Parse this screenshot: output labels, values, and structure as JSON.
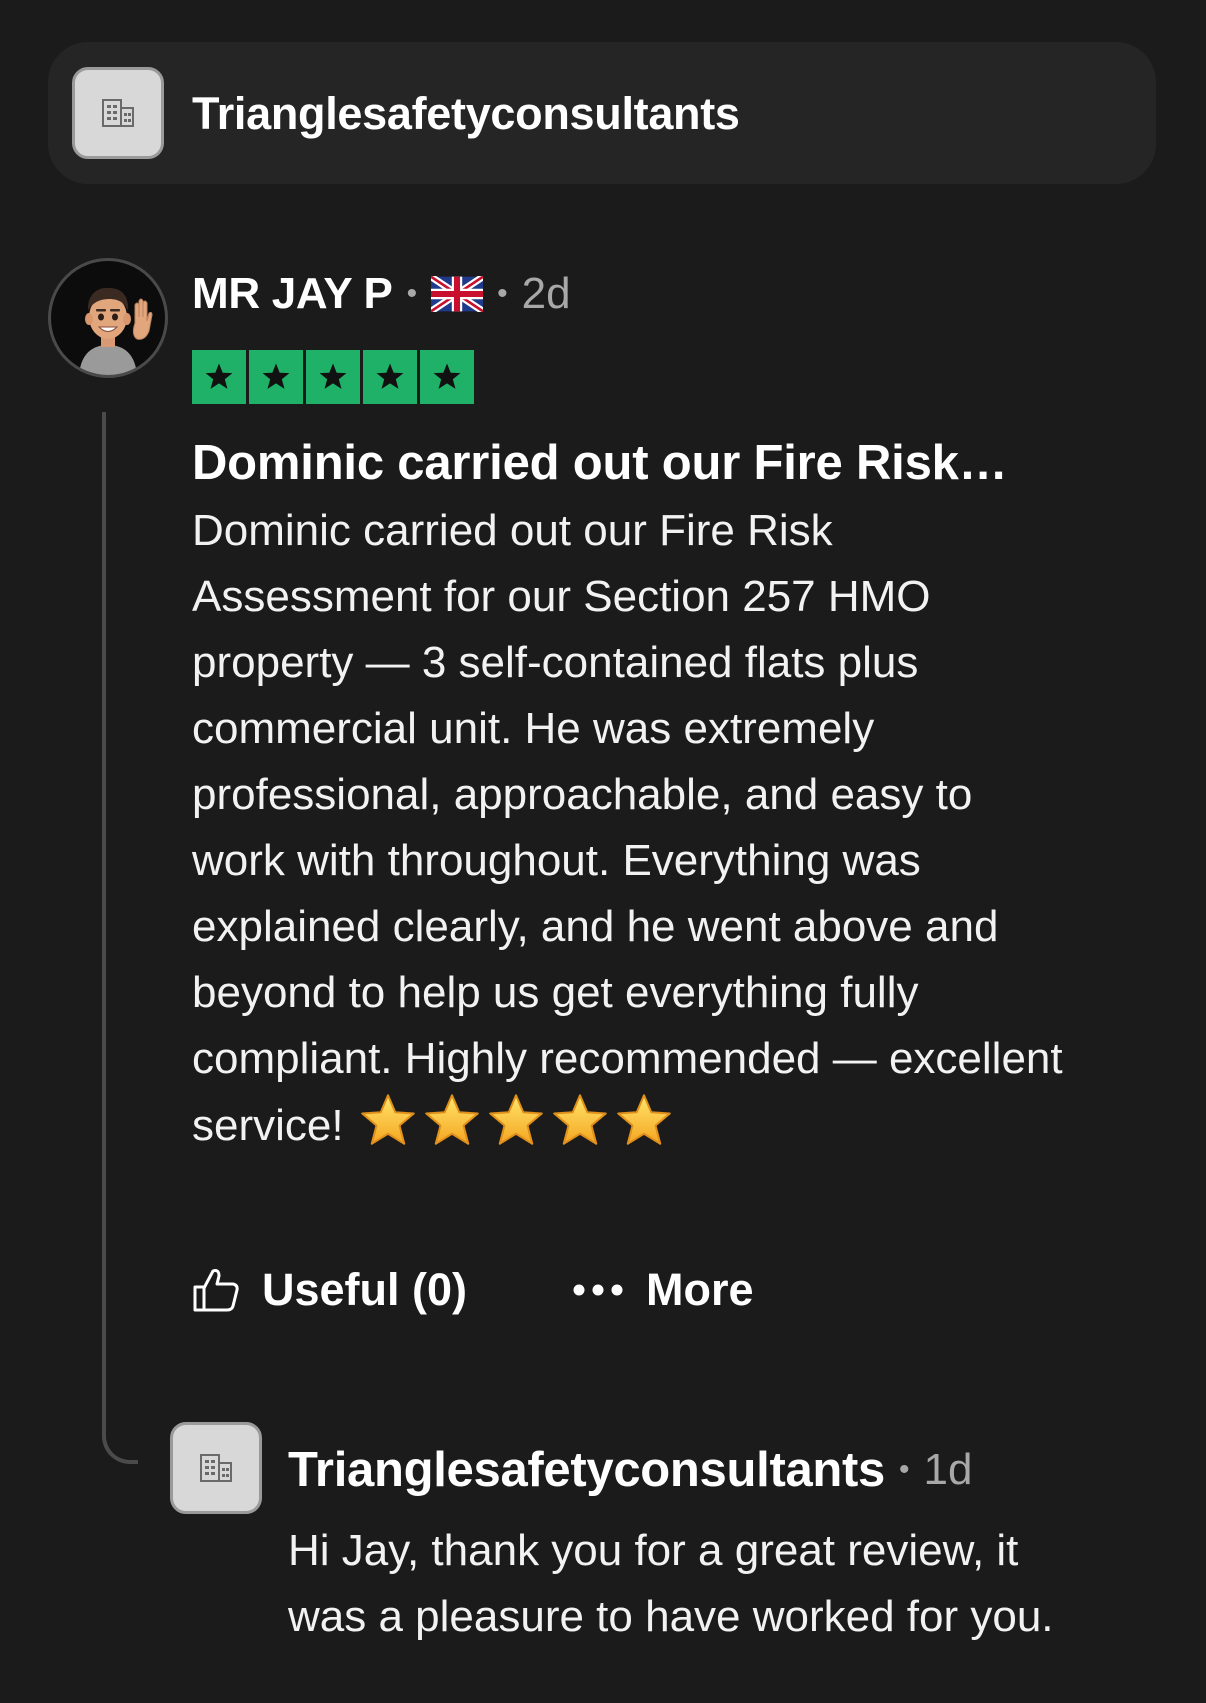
{
  "business": {
    "name": "Trianglesafetyconsultants",
    "logo_icon": "building-icon"
  },
  "review": {
    "author": "MR JAY P",
    "country_icon": "uk-flag-icon",
    "age": "2d",
    "rating": 5,
    "rating_max": 5,
    "title": "Dominic carried out our Fire Risk…",
    "body_lines": [
      "Dominic carried out our Fire Risk",
      "Assessment for our Section 257 HMO",
      "property — 3 self-contained flats plus",
      "commercial unit. He was extremely",
      "professional, approachable, and easy to",
      "work with throughout. Everything was",
      "explained clearly, and he went above and",
      "beyond to help us get everything fully",
      "compliant. Highly recommended — excellent",
      "service!"
    ],
    "emoji_star_count": 5
  },
  "actions": {
    "useful_label": "Useful (0)",
    "more_label": "More"
  },
  "reply": {
    "author": "Trianglesafetyconsultants",
    "age": "1d",
    "body_lines": [
      "Hi Jay, thank you for a great review, it",
      "was a pleasure to have worked for you."
    ]
  },
  "colors": {
    "background": "#1b1b1b",
    "card": "#252525",
    "star_green": "#1fb167",
    "muted_text": "#a8a8a8"
  }
}
